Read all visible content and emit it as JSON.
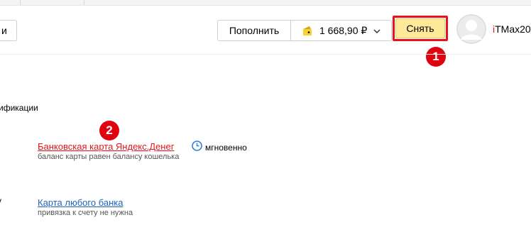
{
  "header": {
    "left_button_label": "и",
    "replenish_label": "Пополнить",
    "wallet": {
      "balance": "1 668,90 ₽",
      "icon": "wallet-icon",
      "accent": "#f7d138"
    },
    "withdraw_label": "Снять",
    "withdraw_color": "#fee99a",
    "user": {
      "name_first_letter": "i",
      "name_rest": "TMax20"
    }
  },
  "annotations": [
    {
      "label": "1",
      "color": "#e0030f"
    },
    {
      "label": "2",
      "color": "#e0030f"
    }
  ],
  "main": {
    "section_label": "ификации",
    "row_marker": "у",
    "options": [
      {
        "title": "Банковская карта Яндекс.Денег",
        "speed": "мгновенно",
        "subtitle": "баланс карты равен балансу кошелька",
        "color": "#e8141d"
      },
      {
        "title": "Карта любого банка",
        "subtitle": "привязка к счету не нужна",
        "color": "#1f63bd"
      }
    ]
  }
}
